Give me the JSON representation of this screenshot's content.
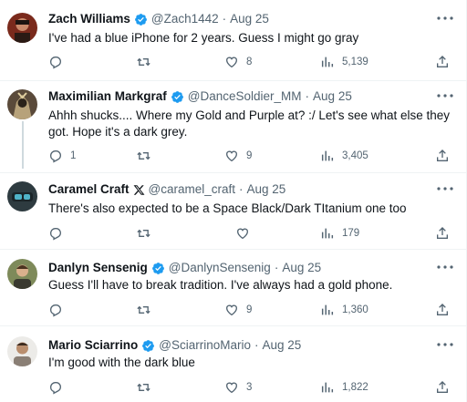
{
  "tweets": [
    {
      "name": "Zach Williams",
      "verified": "blue",
      "handle": "@Zach1442",
      "time": "Aug 25",
      "text": "I've had a blue iPhone for 2 years. Guess I might go gray",
      "replies": "",
      "retweets": "",
      "likes": "8",
      "views": "5,139",
      "avatar_color": "#7a2a1c"
    },
    {
      "name": "Maximilian Markgraf",
      "verified": "blue",
      "handle": "@DanceSoldier_MM",
      "time": "Aug 25",
      "text": "Ahhh shucks.... Where my Gold and Purple at? :/ Let's see what else they got. Hope it's a dark grey.",
      "replies": "1",
      "retweets": "",
      "likes": "9",
      "views": "3,405",
      "avatar_color": "#5a4a3a"
    },
    {
      "name": "Caramel Craft",
      "verified": "x",
      "handle": "@caramel_craft",
      "time": "Aug 25",
      "text": "There's also expected to be a Space Black/Dark TItanium one too",
      "replies": "",
      "retweets": "",
      "likes": "",
      "views": "179",
      "avatar_color": "#2e3b40"
    },
    {
      "name": "Danlyn Sensenig",
      "verified": "blue",
      "handle": "@DanlynSensenig",
      "time": "Aug 25",
      "text": "Guess I'll have to break tradition. I've always had a gold phone.",
      "replies": "",
      "retweets": "",
      "likes": "9",
      "views": "1,360",
      "avatar_color": "#7e8a5a"
    },
    {
      "name": "Mario Sciarrino",
      "verified": "blue",
      "handle": "@SciarrinoMario",
      "time": "Aug 25",
      "text": "I'm good with the dark blue",
      "replies": "",
      "retweets": "",
      "likes": "3",
      "views": "1,822",
      "avatar_color": "#d8d4ce"
    }
  ],
  "colors": {
    "verified": "#1d9bf0",
    "text": "#0f1419",
    "muted": "#536471",
    "divider": "#eff3f4"
  }
}
